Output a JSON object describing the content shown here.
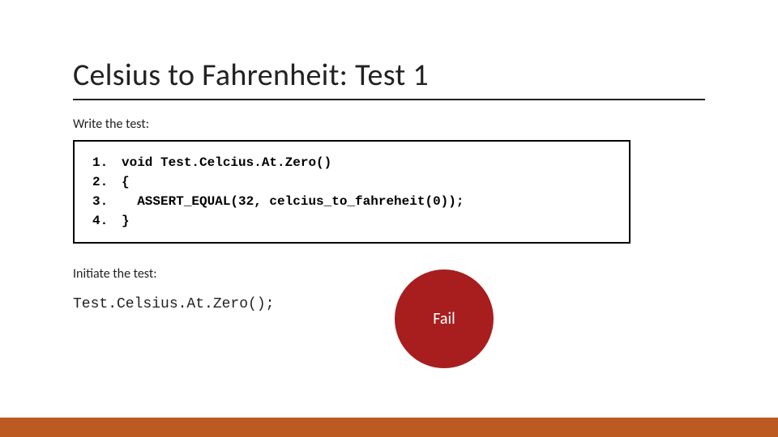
{
  "title": "Celsius to Fahrenheit: Test 1",
  "write_label": "Write the test:",
  "code": {
    "l1": {
      "n": "1.",
      "t": "void Test.Celcius.At.Zero()"
    },
    "l2": {
      "n": "2.",
      "t": "{"
    },
    "l3": {
      "n": "3.",
      "t": "  ASSERT_EQUAL(32, celcius_to_fahreheit(0));"
    },
    "l4": {
      "n": "4.",
      "t": "}"
    }
  },
  "initiate_label": "Initiate the test:",
  "call_text": "Test.Celsius.At.Zero();",
  "fail_text": "Fail",
  "colors": {
    "accent_bar": "#bc5a21",
    "fail_bg": "#a81e1e"
  }
}
